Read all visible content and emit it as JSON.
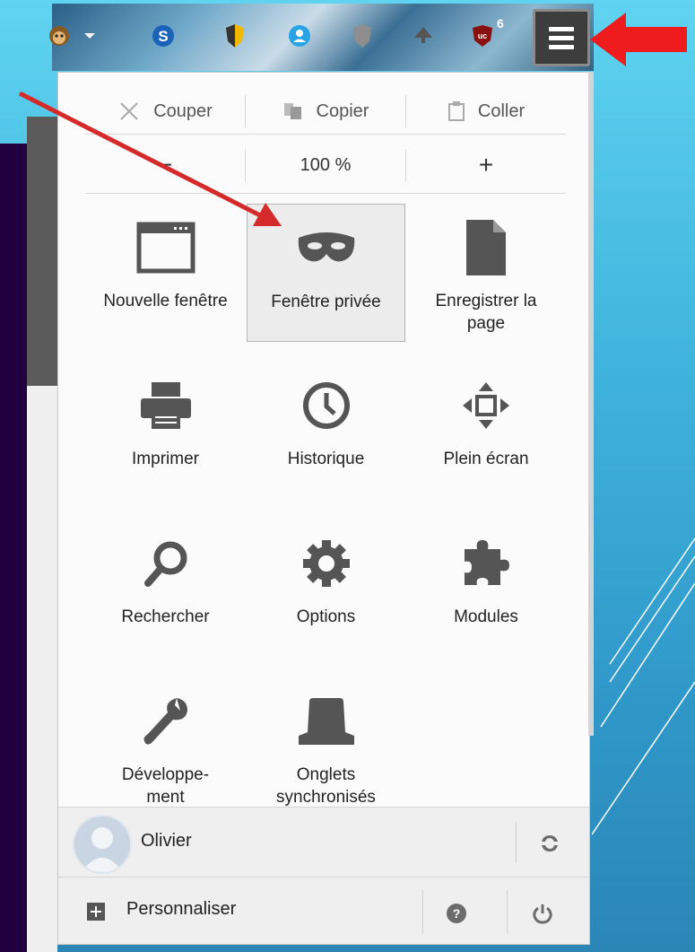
{
  "toolbar": {
    "badge_count": "6",
    "icons": [
      "monkey-icon",
      "dropdown-icon",
      "skype-icon",
      "shield-yellow-icon",
      "person-icon",
      "shield-gray-icon",
      "diamond-icon",
      "ublock-icon"
    ]
  },
  "edit": {
    "cut_label": "Couper",
    "copy_label": "Copier",
    "paste_label": "Coller"
  },
  "zoom": {
    "minus": "−",
    "level": "100 %",
    "plus": "+"
  },
  "items": [
    {
      "label": "Nouvelle fenêtre",
      "icon": "window-icon"
    },
    {
      "label": "Fenêtre privée",
      "icon": "mask-icon"
    },
    {
      "label": "Enregistrer la page",
      "icon": "page-icon"
    },
    {
      "label": "Imprimer",
      "icon": "printer-icon"
    },
    {
      "label": "Historique",
      "icon": "clock-icon"
    },
    {
      "label": "Plein écran",
      "icon": "fullscreen-icon"
    },
    {
      "label": "Rechercher",
      "icon": "magnifier-icon"
    },
    {
      "label": "Options",
      "icon": "gear-icon"
    },
    {
      "label": "Modules",
      "icon": "puzzle-icon"
    },
    {
      "label": "Développe-\nment",
      "icon": "wrench-icon"
    },
    {
      "label": "Onglets synchronisés",
      "icon": "sync-tabs-icon"
    }
  ],
  "footer": {
    "user_name": "Olivier",
    "customize_label": "Personnaliser"
  },
  "colors": {
    "arrow_red": "#d42a2a",
    "accent_red": "#ee1c1c",
    "icon_gray": "#555555"
  }
}
